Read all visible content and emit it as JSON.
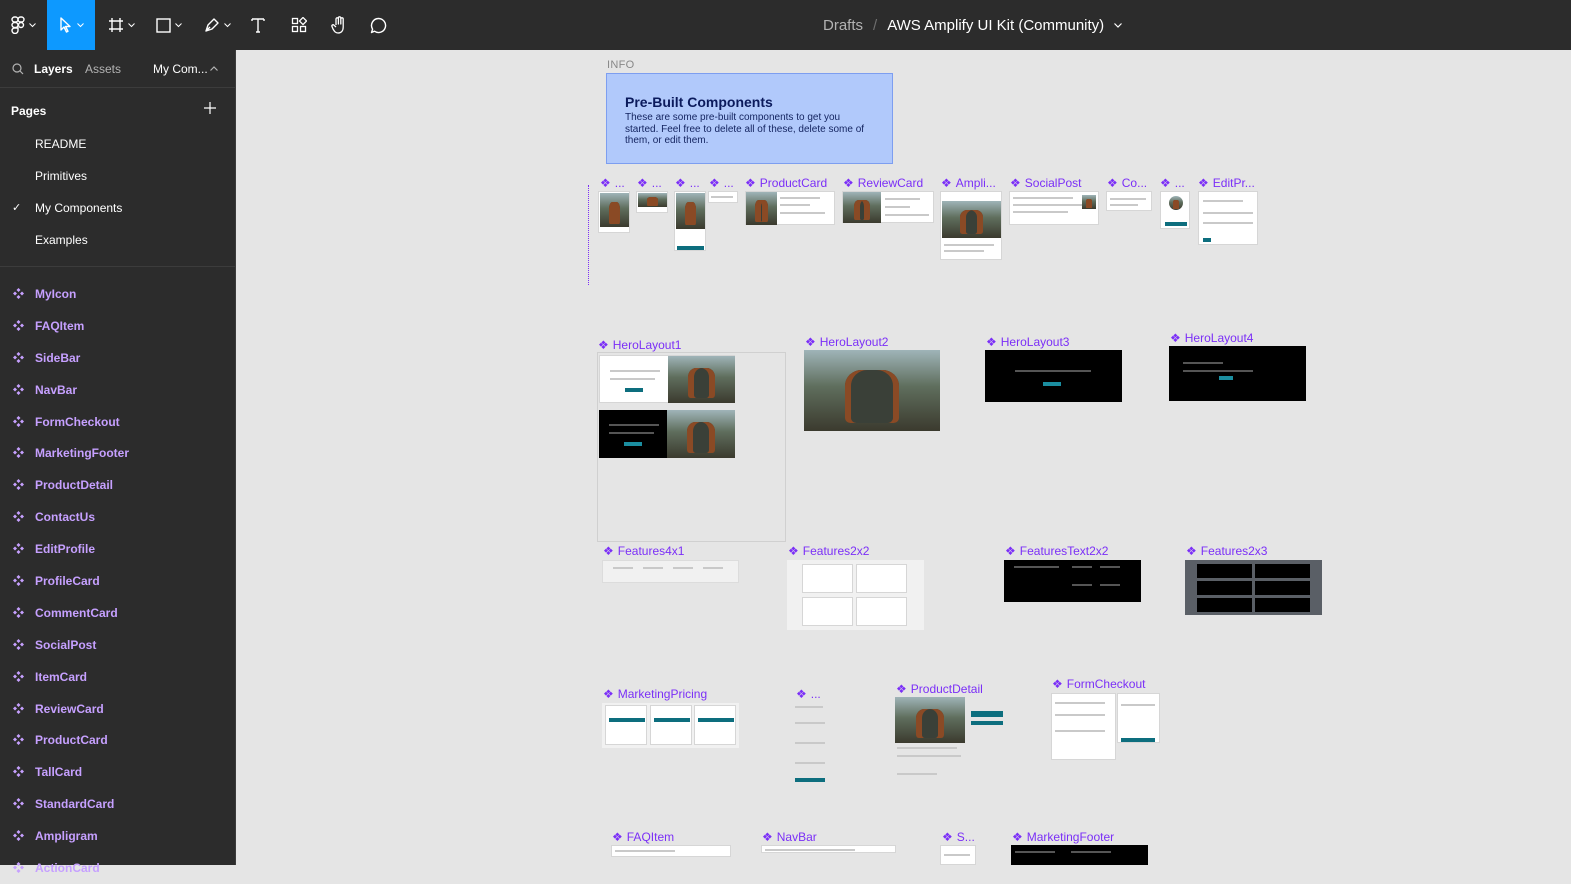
{
  "toolbar": {
    "breadcrumb_drafts": "Drafts",
    "breadcrumb_sep": "/",
    "file_name": "AWS Amplify UI Kit (Community)",
    "accent_color": "#0d99ff"
  },
  "sidebar": {
    "tab_layers": "Layers",
    "tab_assets": "Assets",
    "page_dropdown": "My Com...",
    "pages_heading": "Pages",
    "pages": [
      "README",
      "Primitives",
      "My Components",
      "Examples"
    ],
    "current_page": "My Components",
    "layers": [
      "MyIcon",
      "FAQItem",
      "SideBar",
      "NavBar",
      "FormCheckout",
      "MarketingFooter",
      "ProductDetail",
      "ContactUs",
      "EditProfile",
      "ProfileCard",
      "CommentCard",
      "SocialPost",
      "ItemCard",
      "ReviewCard",
      "ProductCard",
      "TallCard",
      "StandardCard",
      "Ampligram",
      "ActionCard"
    ],
    "component_color": "#c6a0ff"
  },
  "canvas": {
    "info_label": "INFO",
    "info_title": "Pre-Built Components",
    "info_body": "These are some pre-built components to get you started. Feel free to delete all of these, delete some of them, or edit them.",
    "row1_labels": [
      "...",
      "...",
      "...",
      "...",
      "ProductCard",
      "ReviewCard",
      "Ampli...",
      "SocialPost",
      "Co...",
      "...",
      "EditPr..."
    ],
    "hero_labels": [
      "HeroLayout1",
      "HeroLayout2",
      "HeroLayout3",
      "HeroLayout4"
    ],
    "features_labels": [
      "Features4x1",
      "Features2x2",
      "FeaturesText2x2",
      "Features2x3"
    ],
    "row4_labels": [
      "MarketingPricing",
      "...",
      "ProductDetail",
      "FormCheckout"
    ],
    "row5_labels": [
      "FAQItem",
      "NavBar",
      "S...",
      "MarketingFooter"
    ],
    "frame_label_color": "#7b2ff7"
  }
}
